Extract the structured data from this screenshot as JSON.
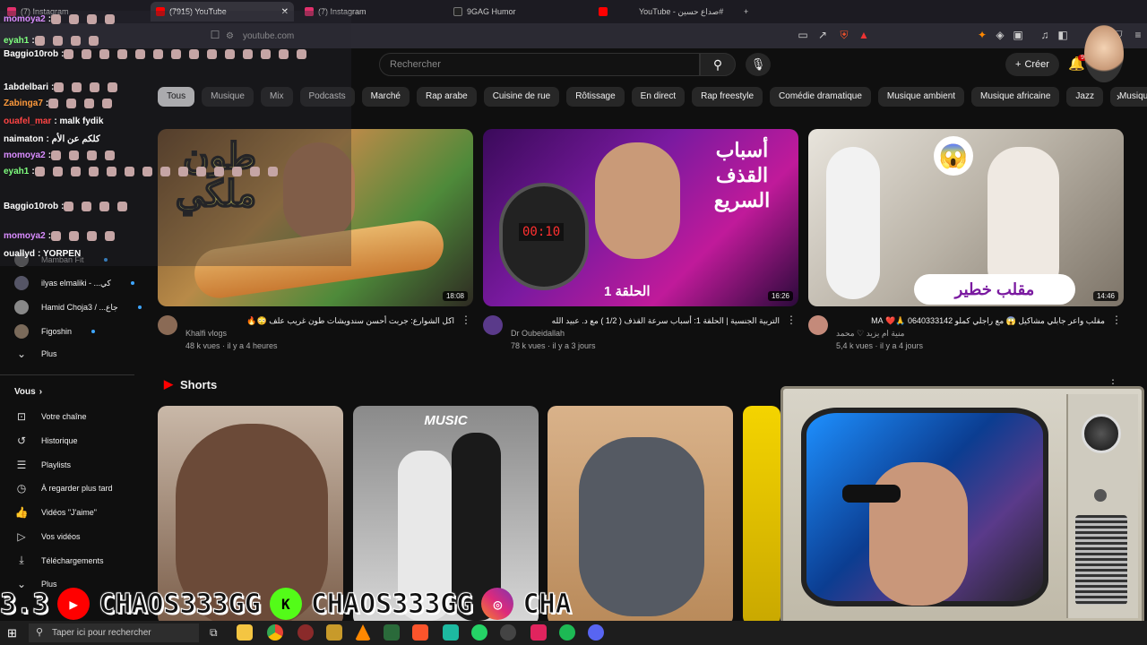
{
  "browser": {
    "tabs": [
      {
        "label": "(7) Instagram",
        "color": "#e1306c"
      },
      {
        "label": "(7915) YouTube",
        "color": "#ff0000",
        "active": true
      },
      {
        "label": "(7) Instagram",
        "color": "#e1306c"
      },
      {
        "label": "9GAG Humor",
        "color": "#222222"
      },
      {
        "label": "YouTube - صداع حسين#",
        "color": "#ff0000"
      }
    ],
    "new_tab": "+",
    "url": "youtube.com"
  },
  "youtube": {
    "search_placeholder": "Rechercher",
    "create_label": "Créer",
    "notif_count": "9+",
    "chips": [
      "Tous",
      "Musique",
      "Mix",
      "Podcasts",
      "Marché",
      "Rap arabe",
      "Cuisine de rue",
      "Rôtissage",
      "En direct",
      "Rap freestyle",
      "Comédie dramatique",
      "Musique ambient",
      "Musique africaine",
      "Jazz",
      "Musique New Age"
    ],
    "videos": [
      {
        "title": "اكل الشوارع: جربت أحسن سندويشات طون غريب علف 😳🔥",
        "channel": "Khalfi vlogs",
        "meta": "48 k vues · il y a 4 heures",
        "duration": "18:08",
        "thumb_text": "طون ملكي"
      },
      {
        "title": "التربية الجنسية | الحلقة 1: أسباب سرعة القذف ( 1/2 ) مع د. عبيد الله",
        "channel": "Dr Oubeidallah",
        "meta": "78 k vues · il y a 3 jours",
        "duration": "16:26",
        "thumb_text": "أسباب القذف السريع",
        "thumb_sub": "الحلقة 1",
        "timer": "00:10"
      },
      {
        "title": "مقلب واعر جابلي مشاكيل 😱 مع راجلي كملو 0640333142 🙏❤️ MA",
        "channel": "منية ام يزيد ♡ محمد",
        "meta": "5,4 k vues · il y a 4 jours",
        "duration": "14:46",
        "thumb_text": "مقلب خطير"
      }
    ],
    "shorts_title": "Shorts",
    "shorts_music_label": "MUSIC"
  },
  "sidebar": {
    "subs_items": [
      {
        "label": "Mamban Fit",
        "dot": true
      },
      {
        "label": "ilyas elmaliki - ...كي",
        "dot": true
      },
      {
        "label": "Hamid Choja3 / ...جاع",
        "dot": true
      },
      {
        "label": "Figoshin",
        "dot": true
      }
    ],
    "more_label": "Plus",
    "you_title": "Vous",
    "you_items": [
      {
        "label": "Votre chaîne",
        "icon": "user-square-icon"
      },
      {
        "label": "Historique",
        "icon": "history-icon"
      },
      {
        "label": "Playlists",
        "icon": "playlist-icon"
      },
      {
        "label": "À regarder plus tard",
        "icon": "clock-icon"
      },
      {
        "label": "Vidéos \"J'aime\"",
        "icon": "thumb-up-icon"
      },
      {
        "label": "Vos vidéos",
        "icon": "video-icon"
      },
      {
        "label": "Téléchargements",
        "icon": "download-icon"
      },
      {
        "label": "Plus",
        "icon": "chevron-down-icon"
      }
    ]
  },
  "chat": [
    {
      "user": "momoya2",
      "text": ":",
      "color": "#d98cff"
    },
    {
      "user": "eyah1",
      "text": ":",
      "color": "#7fff7f"
    },
    {
      "user": "Baggio10rob",
      "text": ":",
      "color": "#ffffff"
    },
    {
      "user": "1abdelbari",
      "text": ":",
      "color": "#ffffff"
    },
    {
      "user": "Zabinga7",
      "text": ":",
      "color": "#ff9a3c"
    },
    {
      "user": "ouafel_mar",
      "text": ": malk fydik",
      "color": "#ff4444"
    },
    {
      "user": "naimaton",
      "text": ": كلكم عن الأم",
      "color": "#ffffff"
    },
    {
      "user": "momoya2",
      "text": ":",
      "color": "#d98cff"
    },
    {
      "user": "eyah1",
      "text": ":",
      "color": "#7fff7f"
    },
    {
      "user": "Baggio10rob",
      "text": ":",
      "color": "#ffffff"
    },
    {
      "user": "momoya2",
      "text": ":",
      "color": "#d98cff"
    },
    {
      "user": "ouallyd",
      "text": ": YORPEN",
      "color": "#ffffff"
    }
  ],
  "ticker": {
    "handle": "CHAOS333GG",
    "prefix": "3.3",
    "tail": "CHA"
  },
  "taskbar": {
    "search_placeholder": "Taper ici pour rechercher"
  }
}
